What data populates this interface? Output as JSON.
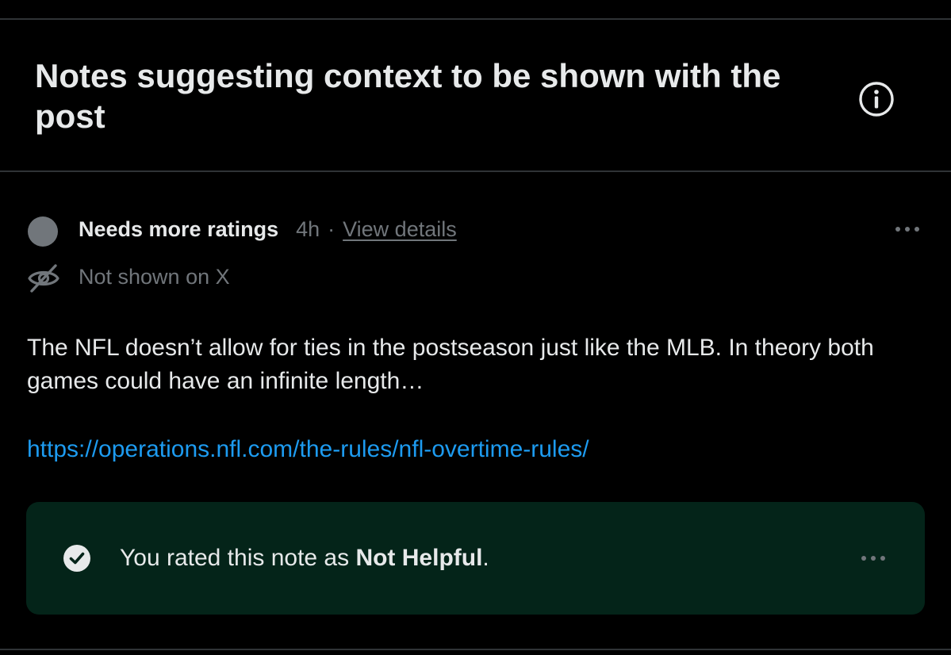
{
  "header": {
    "title": "Notes suggesting context to be shown with the post",
    "info_icon": "info-circle-icon"
  },
  "note": {
    "status_label": "Needs more ratings",
    "time": "4h",
    "separator": "·",
    "view_details": "View details",
    "visibility_text": "Not shown on X",
    "visibility_icon": "eye-slash-icon",
    "more_icon": "ellipsis-icon",
    "body": "The NFL doesn’t allow for ties in the postseason just like the MLB. In theory both games could have an infinite length…",
    "link": "https://operations.nfl.com/the-rules/nfl-overtime-rules/"
  },
  "rating": {
    "prefix": "You rated this note as ",
    "value": "Not Helpful",
    "suffix": ".",
    "check_icon": "check-circle-icon",
    "more_icon": "ellipsis-icon"
  },
  "colors": {
    "background": "#000000",
    "primary_text": "#e7e9ea",
    "secondary_text": "#71767b",
    "link": "#1d9bf0",
    "rating_box": "#042419",
    "divider": "#2f3336"
  }
}
